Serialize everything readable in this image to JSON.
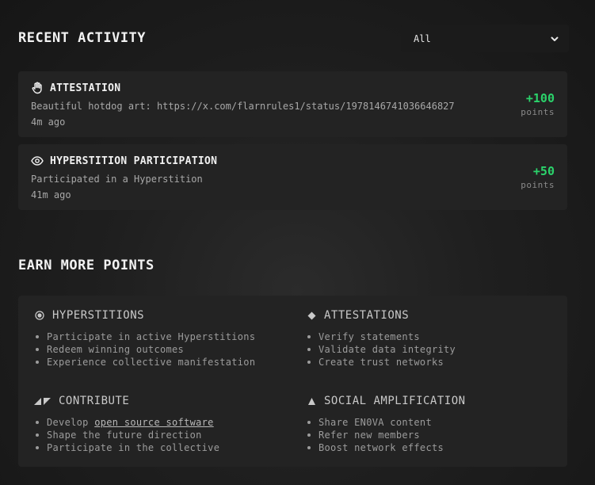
{
  "recent": {
    "title": "RECENT ACTIVITY",
    "filter": {
      "selected": "All"
    },
    "items": [
      {
        "icon": "hand-icon",
        "title": "ATTESTATION",
        "description": "Beautiful hotdog art: https://x.com/flarnrules1/status/1978146741036646827",
        "time": "4m ago",
        "points": "+100",
        "points_label": "points"
      },
      {
        "icon": "eye-icon",
        "title": "HYPERSTITION PARTICIPATION",
        "description": "Participated in a Hyperstition",
        "time": "41m ago",
        "points": "+50",
        "points_label": "points"
      }
    ]
  },
  "earn": {
    "title": "EARN MORE POINTS",
    "sections": [
      {
        "icon": "target-circle-icon",
        "title": "HYPERSTITIONS",
        "items": [
          "Participate in active Hyperstitions",
          "Redeem winning outcomes",
          "Experience collective manifestation"
        ]
      },
      {
        "icon": "diamond-icon",
        "title": "ATTESTATIONS",
        "items": [
          "Verify statements",
          "Validate data integrity",
          "Create trust networks"
        ]
      },
      {
        "icon": "contribute-triangles-icon",
        "title": "CONTRIBUTE",
        "items_prefix": "Develop ",
        "items_link": "open source software",
        "items": [
          "Shape the future direction",
          "Participate in the collective"
        ]
      },
      {
        "icon": "triangle-up-icon",
        "title": "SOCIAL AMPLIFICATION",
        "items": [
          "Share EN0VA content",
          "Refer new members",
          "Boost network effects"
        ]
      }
    ]
  },
  "colors": {
    "accent_green": "#2bd36b",
    "card_bg": "#232323"
  }
}
